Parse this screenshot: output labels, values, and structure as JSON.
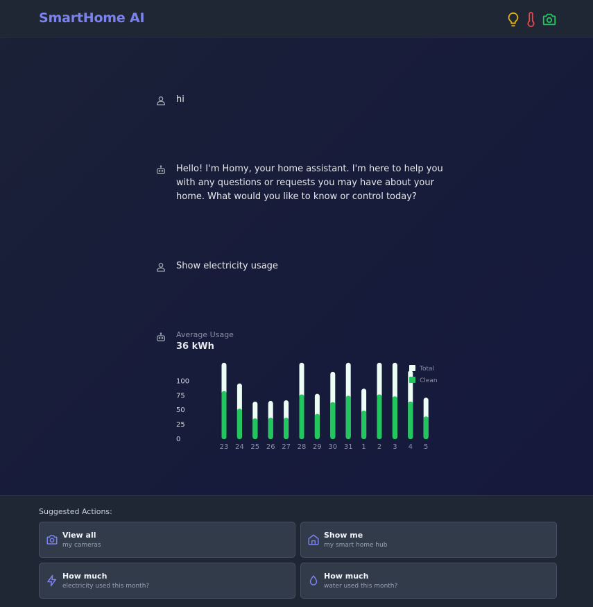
{
  "app": {
    "title": "SmartHome AI",
    "header_icons": [
      {
        "name": "lightbulb-icon",
        "color": "#eab308"
      },
      {
        "name": "thermometer-icon",
        "color": "#ef4444"
      },
      {
        "name": "camera-icon",
        "color": "#22c55e"
      }
    ]
  },
  "conversation": [
    {
      "role": "user",
      "text": "hi"
    },
    {
      "role": "assistant",
      "text": "Hello! I'm Homy, your home assistant. I'm here to help you with any questions or requests you may have about your home. What would you like to know or control today?"
    },
    {
      "role": "user",
      "text": "Show electricity usage"
    }
  ],
  "usage": {
    "label": "Average Usage",
    "value": "36 kWh"
  },
  "chart_data": {
    "type": "bar",
    "categories": [
      "23",
      "24",
      "25",
      "26",
      "27",
      "28",
      "29",
      "30",
      "31",
      "1",
      "2",
      "3",
      "4",
      "5"
    ],
    "series": [
      {
        "name": "Total",
        "color": "#ecfdf5",
        "values": [
          118,
          86,
          58,
          59,
          60,
          118,
          70,
          104,
          118,
          78,
          118,
          118,
          106,
          64
        ]
      },
      {
        "name": "Clean",
        "color": "#22c55e",
        "values": [
          74,
          47,
          32,
          33,
          33,
          69,
          39,
          57,
          67,
          44,
          69,
          66,
          58,
          35
        ]
      }
    ],
    "yticks": [
      0,
      25,
      50,
      75,
      100
    ],
    "ylim": [
      0,
      120
    ],
    "legend_position": "right",
    "grid": false
  },
  "suggested": {
    "title": "Suggested Actions:",
    "actions": [
      {
        "icon": "camera-icon",
        "title": "View all",
        "subtitle": "my cameras"
      },
      {
        "icon": "home-icon",
        "title": "Show me",
        "subtitle": "my smart home hub"
      },
      {
        "icon": "lightning-icon",
        "title": "How much",
        "subtitle": "electricity used this month?"
      },
      {
        "icon": "water-drop-icon",
        "title": "How much",
        "subtitle": "water used this month?"
      }
    ]
  }
}
